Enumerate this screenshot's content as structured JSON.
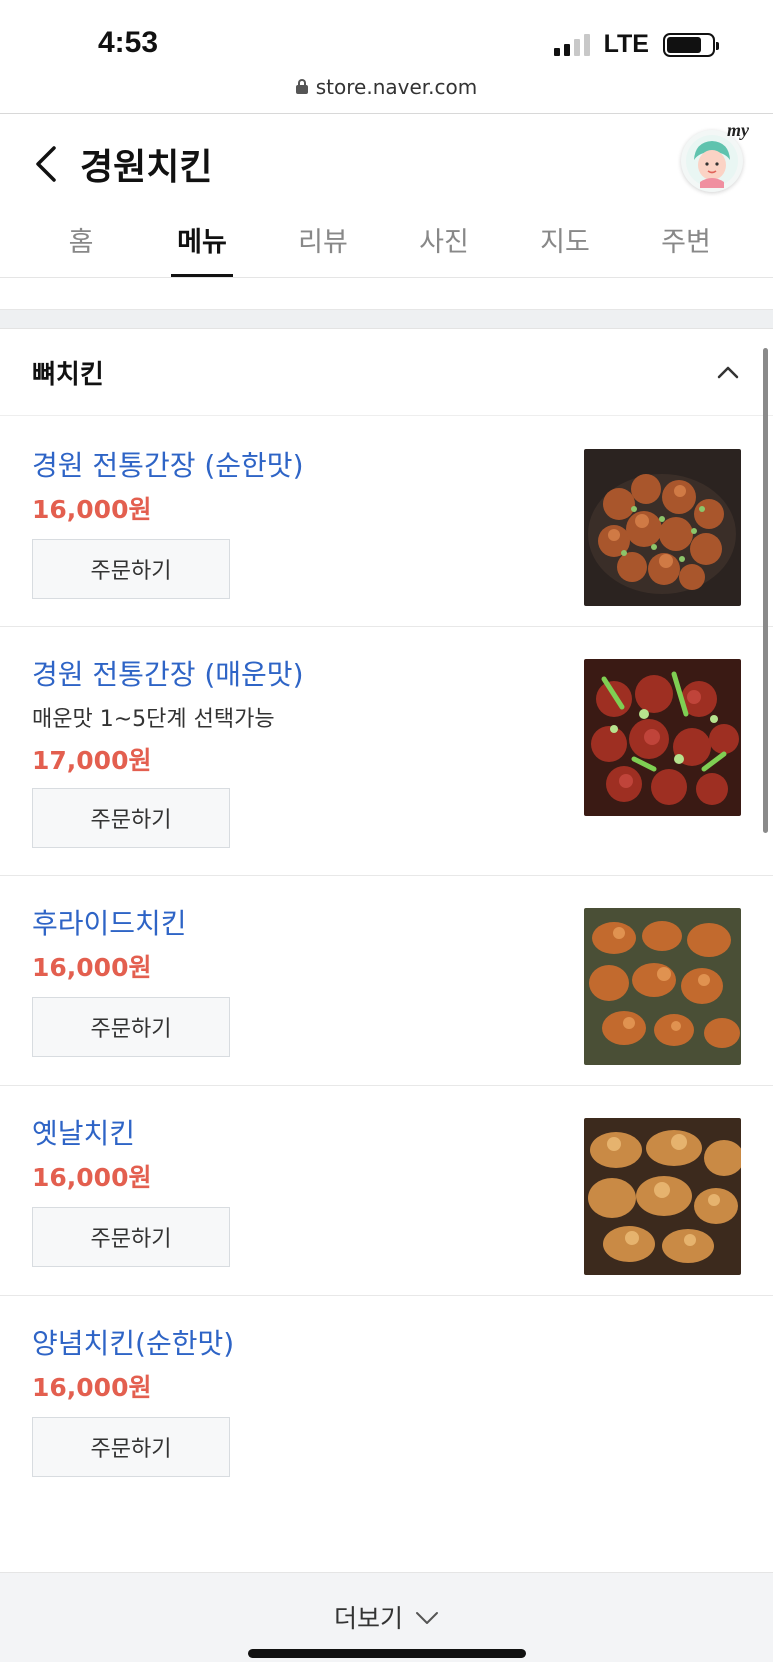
{
  "status_bar": {
    "time": "4:53",
    "network": "LTE"
  },
  "browser": {
    "url": "store.naver.com"
  },
  "header": {
    "title": "경원치킨",
    "my_label": "my"
  },
  "tabs": [
    {
      "label": "홈"
    },
    {
      "label": "메뉴"
    },
    {
      "label": "리뷰"
    },
    {
      "label": "사진"
    },
    {
      "label": "지도"
    },
    {
      "label": "주변"
    }
  ],
  "active_tab": "메뉴",
  "section": {
    "title": "뼈치킨"
  },
  "menu_items": [
    {
      "name": "경원 전통간장 (순한맛)",
      "description": "",
      "price": "16,000원",
      "order_label": "주문하기",
      "has_photo": true,
      "photo": "soy-chicken-mild"
    },
    {
      "name": "경원 전통간장 (매운맛)",
      "description": "매운맛 1~5단계 선택가능",
      "price": "17,000원",
      "order_label": "주문하기",
      "has_photo": true,
      "photo": "soy-chicken-spicy"
    },
    {
      "name": "후라이드치킨",
      "description": "",
      "price": "16,000원",
      "order_label": "주문하기",
      "has_photo": true,
      "photo": "fried-chicken"
    },
    {
      "name": "옛날치킨",
      "description": "",
      "price": "16,000원",
      "order_label": "주문하기",
      "has_photo": true,
      "photo": "old-style-chicken"
    },
    {
      "name": "양념치킨(순한맛)",
      "description": "",
      "price": "16,000원",
      "order_label": "주문하기",
      "has_photo": false
    }
  ],
  "more": {
    "label": "더보기"
  },
  "colors": {
    "item_name": "#2e64c6",
    "price": "#e35f4f",
    "order_button_bg": "#f7f8f9",
    "more_bar_bg": "#f3f4f6"
  }
}
